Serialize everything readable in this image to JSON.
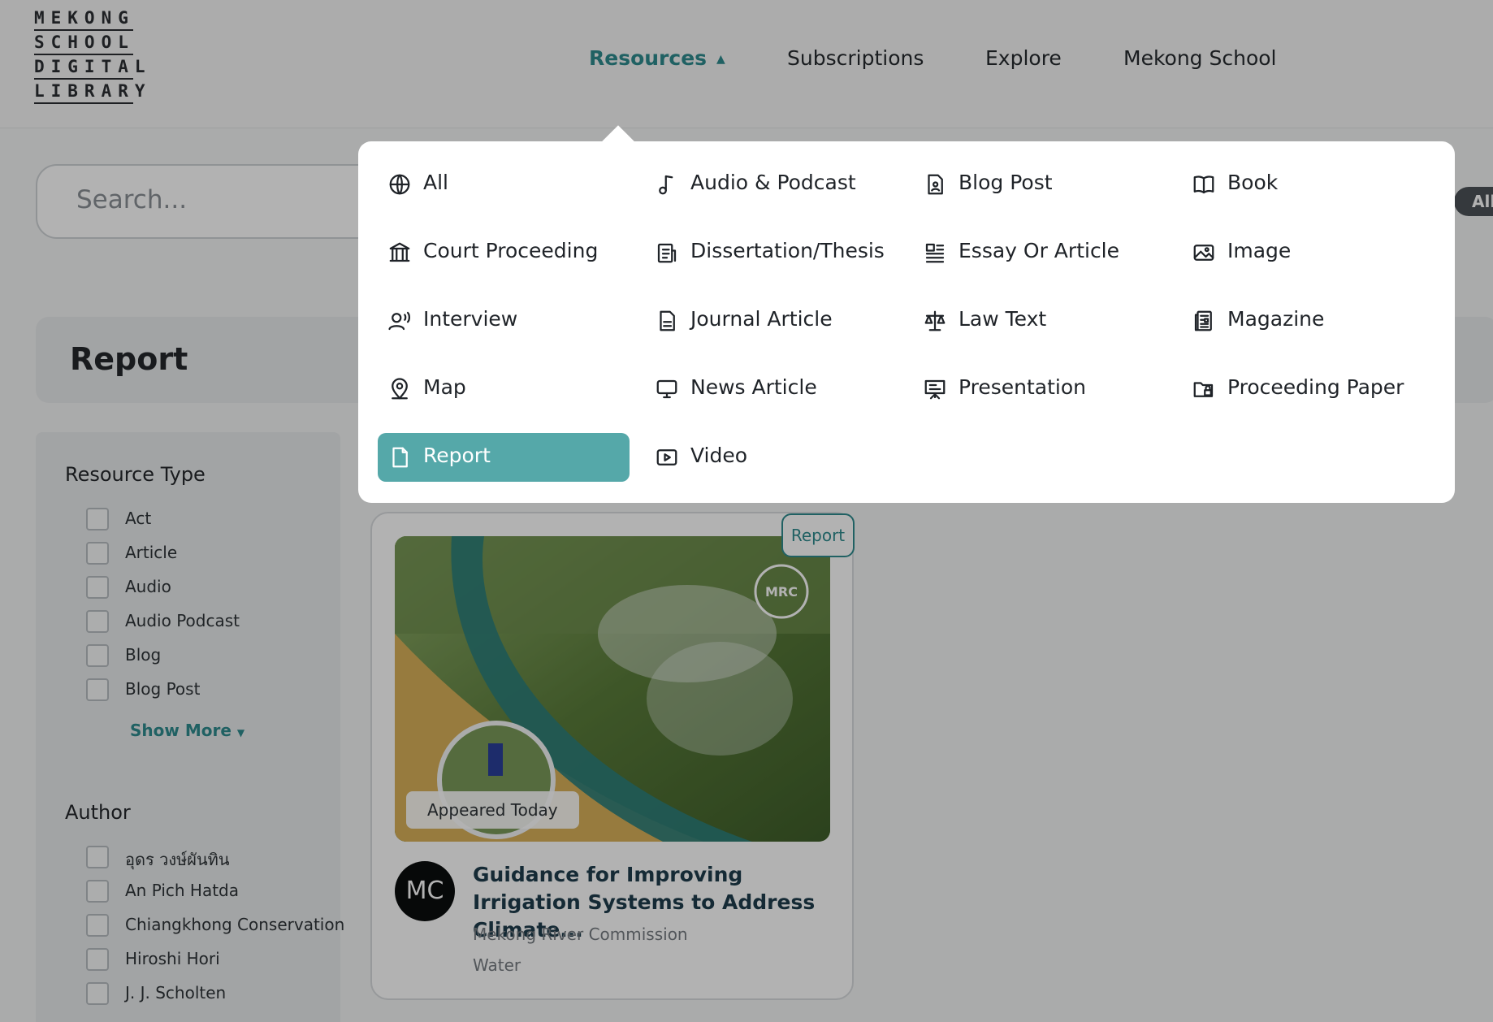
{
  "logo": {
    "rows": [
      "MEKONG",
      "SCHOOL",
      "DIGITAL",
      "LIBRARY"
    ]
  },
  "nav": {
    "resources_label": "Resources",
    "subscriptions_label": "Subscriptions",
    "explore_label": "Explore",
    "mekong_school_label": "Mekong School"
  },
  "search": {
    "placeholder": "Search...",
    "filter_chip": "All"
  },
  "page_title": "Report",
  "filters": {
    "resource_type": {
      "heading": "Resource Type",
      "options": [
        "Act",
        "Article",
        "Audio",
        "Audio Podcast",
        "Blog",
        "Blog Post"
      ],
      "show_more": "Show More"
    },
    "author": {
      "heading": "Author",
      "options": [
        "อุดร วงษ์ผันทิน",
        "An Pich Hatda",
        "Chiangkhong Conservation",
        "Hiroshi Hori",
        "J. J. Scholten"
      ]
    }
  },
  "card": {
    "badge": "Report",
    "appeared": "Appeared Today",
    "avatar_initials": "MC",
    "title": "Guidance for Improving Irrigation Systems to Address Climate...",
    "author": "Mekong River Commission",
    "topic": "Water",
    "image_logo": "MRC"
  },
  "dropdown": {
    "items": [
      {
        "label": "All",
        "icon": "globe-icon"
      },
      {
        "label": "Audio & Podcast",
        "icon": "music-note-icon"
      },
      {
        "label": "Blog Post",
        "icon": "blog-post-icon"
      },
      {
        "label": "Book",
        "icon": "book-icon"
      },
      {
        "label": "Court Proceeding",
        "icon": "courthouse-icon"
      },
      {
        "label": "Dissertation/Thesis",
        "icon": "thesis-icon"
      },
      {
        "label": "Essay Or Article",
        "icon": "article-lines-icon"
      },
      {
        "label": "Image",
        "icon": "image-icon"
      },
      {
        "label": "Interview",
        "icon": "interview-icon"
      },
      {
        "label": "Journal Article",
        "icon": "document-icon"
      },
      {
        "label": "Law Text",
        "icon": "scales-icon"
      },
      {
        "label": "Magazine",
        "icon": "magazine-icon"
      },
      {
        "label": "Map",
        "icon": "map-pin-icon"
      },
      {
        "label": "News Article",
        "icon": "monitor-icon"
      },
      {
        "label": "Presentation",
        "icon": "presentation-icon"
      },
      {
        "label": "Proceeding Paper",
        "icon": "folder-lock-icon"
      },
      {
        "label": "Report",
        "icon": "report-icon"
      },
      {
        "label": "Video",
        "icon": "video-icon"
      }
    ],
    "selected": "Report"
  },
  "colors": {
    "accent": "#2f8b8f",
    "selected_bg": "#55a8a9",
    "overlay": "rgba(0,0,0,0.30)"
  }
}
